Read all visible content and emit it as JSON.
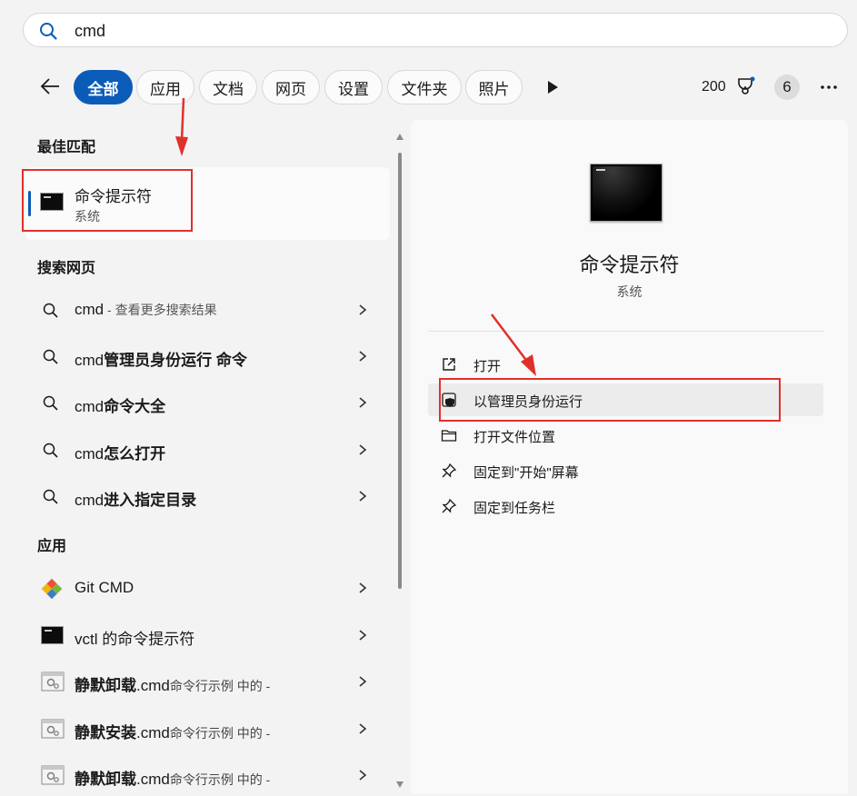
{
  "search": {
    "query": "cmd"
  },
  "filters": [
    {
      "label": "全部",
      "active": true
    },
    {
      "label": "应用"
    },
    {
      "label": "文档"
    },
    {
      "label": "网页"
    },
    {
      "label": "设置"
    },
    {
      "label": "文件夹"
    },
    {
      "label": "照片"
    }
  ],
  "header_right": {
    "points": "200",
    "badge": "6"
  },
  "best_match": {
    "section_title": "最佳匹配",
    "title": "命令提示符",
    "subtitle": "系统"
  },
  "web_search": {
    "section_title": "搜索网页",
    "items": [
      {
        "prefix": "cmd",
        "bold": "",
        "hint": " - 查看更多搜索结果"
      },
      {
        "prefix": "cmd",
        "bold": "管理员身份运行 命令",
        "hint": ""
      },
      {
        "prefix": "cmd",
        "bold": "命令大全",
        "hint": ""
      },
      {
        "prefix": "cmd",
        "bold": "怎么打开",
        "hint": ""
      },
      {
        "prefix": "cmd",
        "bold": "进入指定目录",
        "hint": ""
      }
    ]
  },
  "apps": {
    "section_title": "应用",
    "items": [
      {
        "icon": "git-icon",
        "bold": "",
        "text": "Git CMD",
        "small": ""
      },
      {
        "icon": "cmd-icon",
        "bold": "",
        "text": "vctl 的命令提示符",
        "small": ""
      },
      {
        "icon": "script-icon",
        "bold": "静默卸载",
        "text": ".cmd",
        "small": "命令行示例 中的 -"
      },
      {
        "icon": "script-icon",
        "bold": "静默安装",
        "text": ".cmd",
        "small": "命令行示例 中的 -"
      },
      {
        "icon": "script-icon",
        "bold": "静默卸载",
        "text": ".cmd",
        "small": "命令行示例 中的 -"
      }
    ]
  },
  "detail": {
    "title": "命令提示符",
    "subtitle": "系统",
    "actions": [
      {
        "icon": "open-icon",
        "label": "打开"
      },
      {
        "icon": "shield-icon",
        "label": "以管理员身份运行"
      },
      {
        "icon": "folder-icon",
        "label": "打开文件位置"
      },
      {
        "icon": "pin-icon",
        "label": "固定到\"开始\"屏幕"
      },
      {
        "icon": "pin-icon",
        "label": "固定到任务栏"
      }
    ]
  },
  "colors": {
    "accent": "#0a5cb8",
    "annotation": "#e0302c"
  }
}
